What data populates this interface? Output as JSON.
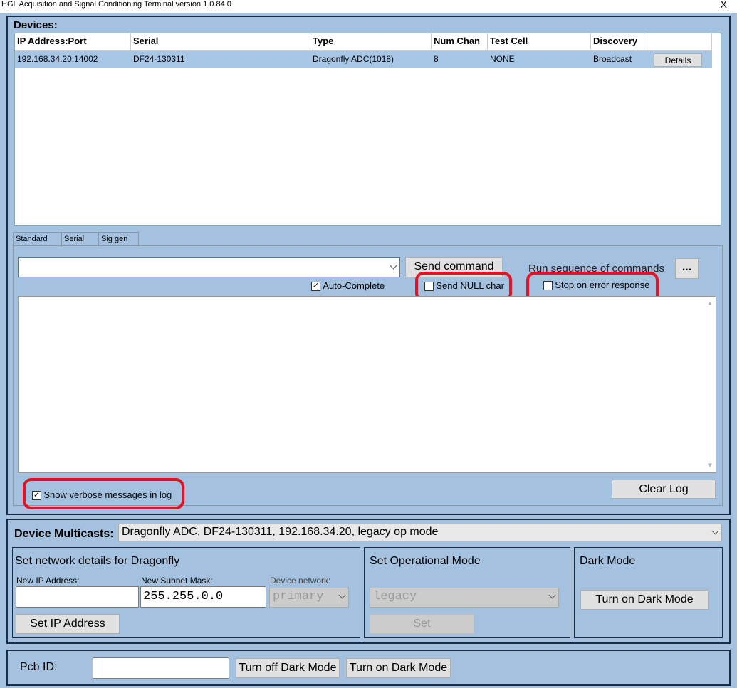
{
  "window": {
    "title": "HGL Acquisition and Signal Conditioning Terminal version 1.0.84.0",
    "close": "X"
  },
  "devices": {
    "header": "Devices:",
    "columns": [
      "IP Address:Port",
      "Serial",
      "Type",
      "Num Chan",
      "Test Cell",
      "Discovery"
    ],
    "rows": [
      {
        "ip": "192.168.34.20:14002",
        "serial": "DF24-130311",
        "type": "Dragonfly ADC(1018)",
        "num_chan": "8",
        "test_cell": "NONE",
        "discovery": "Broadcast",
        "details": "Details"
      }
    ]
  },
  "tabs": [
    "Standard",
    "Serial",
    "Sig gen"
  ],
  "command": {
    "value": "",
    "send_label": "Send command",
    "auto_complete_label": "Auto-Complete",
    "auto_complete_checked": true,
    "send_null_label": "Send NULL char",
    "send_null_checked": false,
    "run_sequence_label": "Run sequence of commands",
    "run_sequence_button": "...",
    "stop_on_error_label": "Stop on error response",
    "stop_on_error_checked": false,
    "verbose_label": "Show verbose messages in log",
    "verbose_checked": true,
    "clear_log_label": "Clear Log"
  },
  "multicast": {
    "label": "Device Multicasts:",
    "selected": "Dragonfly ADC, DF24-130311, 192.168.34.20, legacy op mode"
  },
  "network": {
    "title": "Set network details for Dragonfly",
    "ip_label": "New IP Address:",
    "ip_value": "",
    "mask_label": "New Subnet Mask:",
    "mask_value": "255.255.0.0",
    "device_network_label": "Device network:",
    "device_network_value": "primary",
    "set_ip_label": "Set IP Address"
  },
  "op_mode": {
    "title": "Set Operational Mode",
    "value": "legacy",
    "set_label": "Set"
  },
  "dark_mode": {
    "title": "Dark Mode",
    "turn_on_label": "Turn on Dark Mode"
  },
  "bottom": {
    "pcb_label": "Pcb ID:",
    "pcb_value": "",
    "turn_off_label": "Turn off Dark Mode",
    "turn_on_label": "Turn on Dark Mode"
  },
  "colors": {
    "background": "#a4c2df",
    "highlight": "#e81123",
    "selected_row": "#a8c7e6"
  }
}
